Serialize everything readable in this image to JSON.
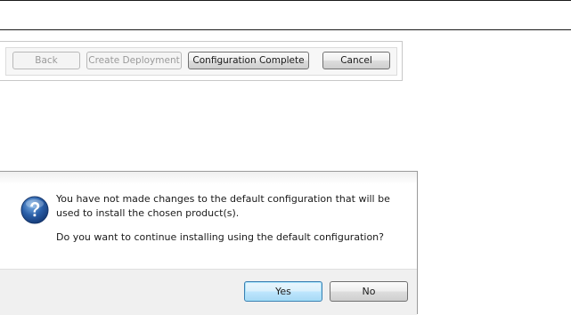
{
  "toolbar": {
    "back_label": "Back",
    "create_deployment_label": "Create Deployment",
    "configuration_complete_label": "Configuration Complete",
    "cancel_label": "Cancel"
  },
  "dialog": {
    "icon": "question-icon",
    "message_line1": "You have not made changes to the default configuration that will be",
    "message_line2": "used to install the chosen product(s).",
    "question": "Do you want to continue installing using the default configuration?",
    "yes_label": "Yes",
    "no_label": "No"
  },
  "colors": {
    "question_icon": "#2a5fa8",
    "default_button_border": "#3c7fb1"
  }
}
